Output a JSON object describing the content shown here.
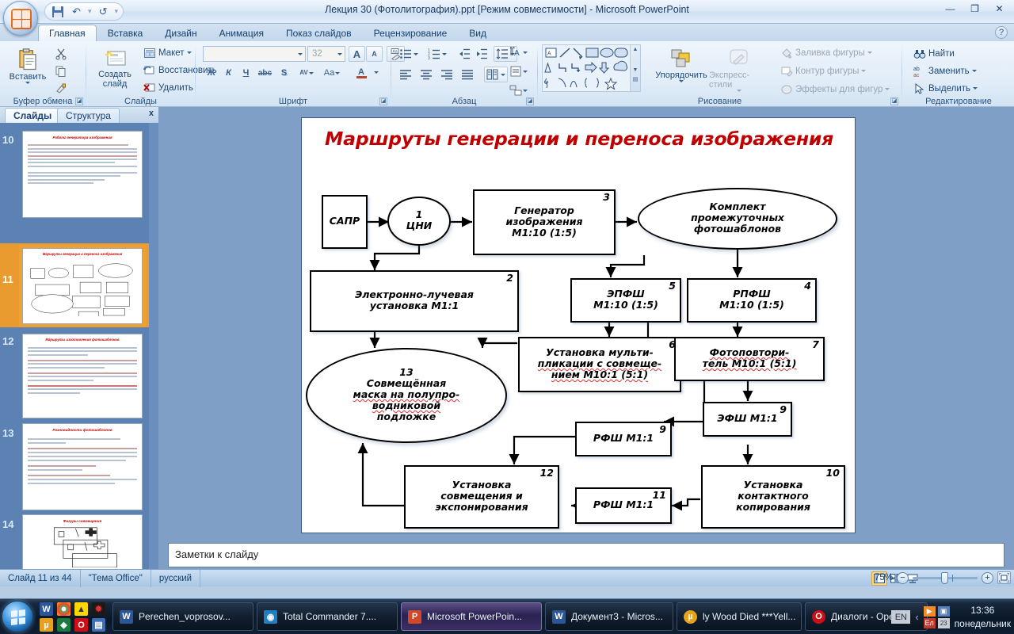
{
  "window": {
    "title": "Лекция 30 (Фотолитография).ppt [Режим совместимости] - Microsoft PowerPoint",
    "minimize": "—",
    "restore": "❐",
    "close": "✕",
    "help": "?"
  },
  "qat": {
    "save": "save-icon",
    "undo": "↶",
    "undo_caret": "▾",
    "redo": "↺",
    "more": "▾"
  },
  "ribbon": {
    "tabs": [
      {
        "label": "Главная",
        "active": true
      },
      {
        "label": "Вставка",
        "active": false
      },
      {
        "label": "Дизайн",
        "active": false
      },
      {
        "label": "Анимация",
        "active": false
      },
      {
        "label": "Показ слайдов",
        "active": false
      },
      {
        "label": "Рецензирование",
        "active": false
      },
      {
        "label": "Вид",
        "active": false
      }
    ],
    "groups": {
      "clipboard": {
        "label": "Буфер обмена",
        "paste": "Вставить",
        "cut": "scissors-icon",
        "copy": "copy-icon",
        "format_painter": "format-painter-icon"
      },
      "slides": {
        "label": "Слайды",
        "new_slide": "Создать слайд",
        "layout": "Макет",
        "reset": "Восстановить",
        "delete": "Удалить"
      },
      "font": {
        "label": "Шрифт",
        "font_name": "",
        "font_name_placeholder": "",
        "font_size": "32",
        "grow": "A",
        "shrink": "A",
        "clear_format": "Aa",
        "bold": "Ж",
        "italic": "К",
        "underline": "Ч",
        "strike": "abc",
        "shadow": "S",
        "spacing": "AV",
        "change_case": "Aa",
        "font_color": "A"
      },
      "paragraph": {
        "label": "Абзац",
        "bullets": "bullet-list-icon",
        "numbering": "numbered-list-icon",
        "decrease_indent": "decrease-indent-icon",
        "increase_indent": "increase-indent-icon",
        "line_spacing": "line-spacing-icon",
        "text_direction": "text-direction-icon",
        "align_text": "align-text-icon",
        "convert_smartart": "smartart-icon",
        "align_left": "align-left-icon",
        "align_center": "align-center-icon",
        "align_right": "align-right-icon",
        "justify": "justify-icon",
        "columns": "columns-icon"
      },
      "drawing": {
        "label": "Рисование",
        "arrange": "Упорядочить",
        "quick_styles": "Экспресс-стили",
        "shape_fill": "Заливка фигуры",
        "shape_outline": "Контур фигуры",
        "shape_effects": "Эффекты для фигур"
      },
      "editing": {
        "label": "Редактирование",
        "find": "Найти",
        "replace": "Заменить",
        "select": "Выделить"
      }
    }
  },
  "panel": {
    "tabs": [
      {
        "label": "Слайды",
        "active": true
      },
      {
        "label": "Структура",
        "active": false
      }
    ],
    "close": "x",
    "thumbnails": [
      {
        "number": "10",
        "title": "Работа генератора изображения",
        "selected": false
      },
      {
        "number": "11",
        "title": "Маршруты генерации и переноса изображения",
        "selected": true
      },
      {
        "number": "12",
        "title": "Маршруты изготовления фотошаблонов",
        "selected": false
      },
      {
        "number": "13",
        "title": "Разновидности фотошаблонов",
        "selected": false
      },
      {
        "number": "14",
        "title": "Фигуры совмещения",
        "selected": false
      }
    ]
  },
  "slide": {
    "title": "Маршруты генерации и переноса изображения",
    "page_number": "11",
    "title_color": "#c00000",
    "nodes": [
      {
        "id": "sapr",
        "num": "",
        "lines": [
          "САПР"
        ]
      },
      {
        "id": "cni",
        "num": "",
        "lines": [
          "1",
          "ЦНИ"
        ]
      },
      {
        "id": "gen",
        "num": "3",
        "lines": [
          "Генератор",
          "изображения",
          "М1:10 (1:5)"
        ]
      },
      {
        "id": "kit",
        "num": "",
        "lines": [
          "Комплект",
          "промежуточных",
          "фотошаблонов"
        ]
      },
      {
        "id": "elb",
        "num": "2",
        "lines": [
          "Электронно-лучевая",
          "установка М1:1"
        ]
      },
      {
        "id": "epfsh",
        "num": "5",
        "lines": [
          "ЭПФШ",
          "М1:10 (1:5)"
        ]
      },
      {
        "id": "rpfsh",
        "num": "4",
        "lines": [
          "РПФШ",
          "М1:10 (1:5)"
        ]
      },
      {
        "id": "mult",
        "num": "6",
        "lines": [
          "Установка мульти-",
          "пликации с совмеще-",
          "нием  М10:1 (5:1)"
        ]
      },
      {
        "id": "foto",
        "num": "7",
        "lines": [
          "Фотоповтори-",
          "тель М10:1 (5:1)"
        ]
      },
      {
        "id": "efsh",
        "num": "9",
        "lines": [
          "ЭФШ М1:1"
        ]
      },
      {
        "id": "mask",
        "num": "",
        "lines": [
          "13",
          "Совмещённая",
          "маска на полупро-",
          "водниковой",
          "подложке"
        ]
      },
      {
        "id": "rfsh1",
        "num": "9",
        "lines": [
          "РФШ М1:1"
        ]
      },
      {
        "id": "kont",
        "num": "10",
        "lines": [
          "Установка",
          "контактного",
          "копирования"
        ]
      },
      {
        "id": "rfsh2",
        "num": "11",
        "lines": [
          "РФШ М1:1"
        ]
      },
      {
        "id": "sovm",
        "num": "12",
        "lines": [
          "Установка",
          "совмещения и",
          "экспонирования"
        ]
      }
    ]
  },
  "notes": {
    "placeholder_text": "Заметки к слайду"
  },
  "status": {
    "slide_of": "Слайд 11 из 44",
    "theme": "\"Тема Office\"",
    "language": "русский",
    "zoom": "75%",
    "zoom_out": "−",
    "zoom_in": "+",
    "view_normal": "normal-view-icon",
    "view_sorter": "slide-sorter-icon",
    "view_show": "slideshow-icon",
    "fit_to_window": "fit-window-icon"
  },
  "taskbar": {
    "start": "start-orb",
    "quick_launch": [
      "W",
      "C",
      "A",
      "M",
      "U",
      "G",
      "O",
      "S"
    ],
    "buttons": [
      {
        "label": "Perechen_voprosov...",
        "icon": "word-icon",
        "active": false
      },
      {
        "label": "Total Commander 7....",
        "icon": "total-commander-icon",
        "active": false
      },
      {
        "label": "Microsoft PowerPoin...",
        "icon": "powerpoint-icon",
        "active": true
      },
      {
        "label": "Документ3 - Micros...",
        "icon": "word-icon",
        "active": false
      },
      {
        "label": "ly Wood Died ***Yell...",
        "icon": "utorrent-icon",
        "active": false
      },
      {
        "label": "Диалоги - Opera",
        "icon": "opera-icon",
        "active": false
      }
    ],
    "lang": "EN",
    "lang_secondary": "En",
    "tray_expand": "‹",
    "time": "13:36",
    "day": "понедельник"
  }
}
